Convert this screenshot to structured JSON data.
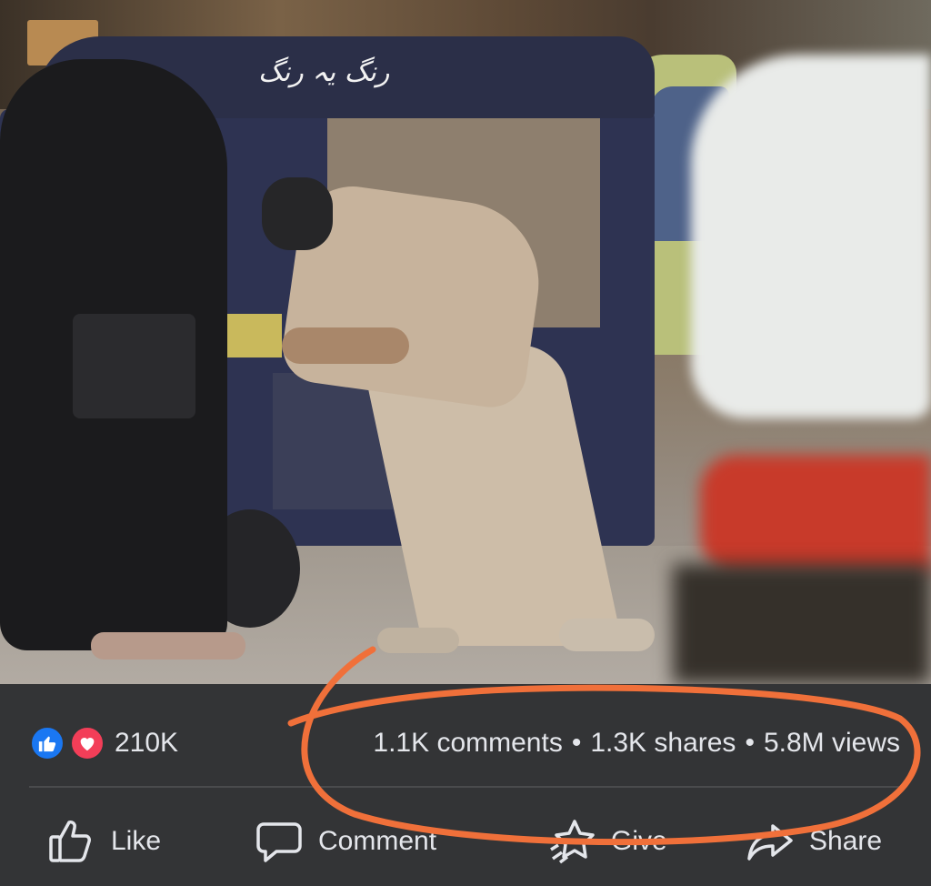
{
  "video": {
    "roof_text": "رنگ یہ رنگ"
  },
  "stats": {
    "reaction_icons": [
      "like-icon",
      "love-icon"
    ],
    "reaction_count": "210K",
    "comments": "1.1K comments",
    "separator": "•",
    "shares": "1.3K shares",
    "views": "5.8M views"
  },
  "actions": {
    "like": "Like",
    "comment": "Comment",
    "give": "Give",
    "share": "Share"
  },
  "colors": {
    "background": "#333436",
    "text": "#e4e6eb",
    "like_blue": "#1a77f2",
    "love_red": "#f33e58",
    "annotation_orange": "#f0703a"
  }
}
